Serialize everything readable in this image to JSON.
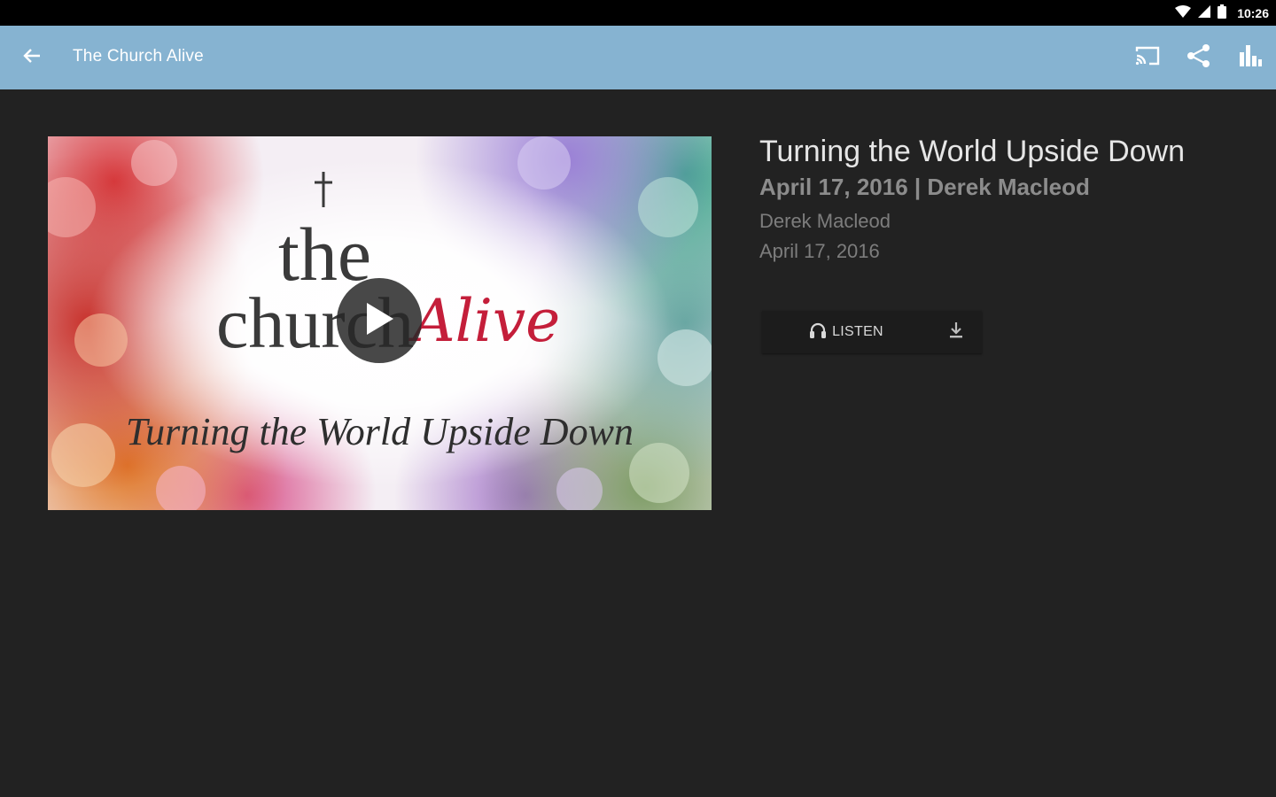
{
  "status_bar": {
    "time": "10:26",
    "icons": [
      "wifi-icon",
      "cell-signal-icon",
      "battery-icon"
    ]
  },
  "app_bar": {
    "title": "The Church Alive",
    "background": "#86b3d1",
    "back_icon": "back-arrow-icon",
    "actions": [
      "cast-icon",
      "share-icon",
      "stats-icon"
    ]
  },
  "sermon": {
    "title": "Turning the World Upside Down",
    "meta": "April 17, 2016 | Derek Macleod",
    "speaker": "Derek Macleod",
    "date": "April 17, 2016"
  },
  "artwork": {
    "line1": "the",
    "line2": "church",
    "line3": "Alive",
    "subtitle": "Turning the World Upside Down",
    "accent": "#c41e3a"
  },
  "media": {
    "listen_label": "LISTEN",
    "listen_icon": "headphones-icon",
    "download_icon": "download-icon"
  }
}
